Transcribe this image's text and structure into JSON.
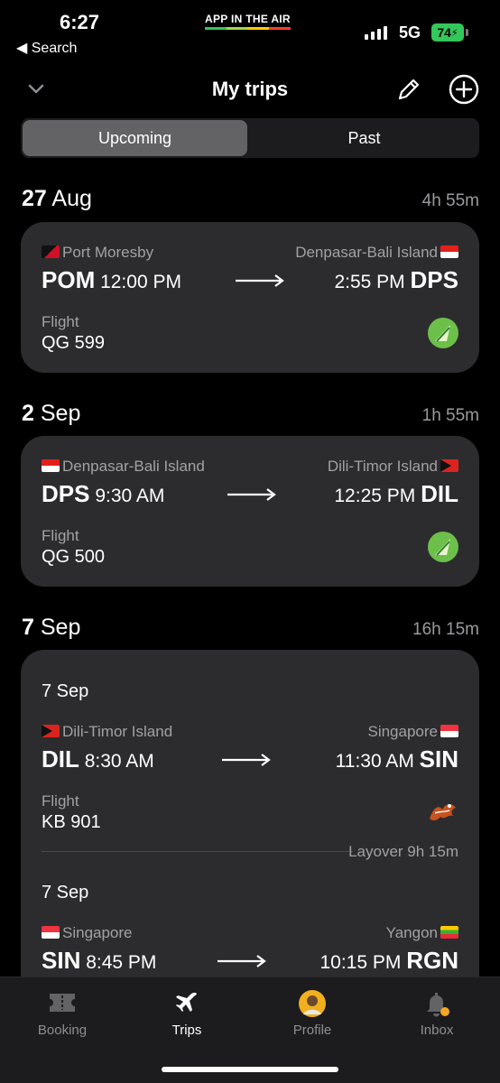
{
  "status_bar": {
    "time": "6:27",
    "back_label": "◀ Search",
    "app_banner": "APP IN THE AIR",
    "network": "5G",
    "battery": "74"
  },
  "nav": {
    "title": "My trips"
  },
  "segments": {
    "upcoming": "Upcoming",
    "past": "Past",
    "selected": "Upcoming"
  },
  "trips": [
    {
      "date_day": "27",
      "date_month": "Aug",
      "duration": "4h 55m",
      "legs": [
        {
          "from_city": "Port Moresby",
          "to_city": "Denpasar-Bali Island",
          "from_code": "POM",
          "dep_time": "12:00 PM",
          "arr_time": "2:55 PM",
          "to_code": "DPS",
          "type_label": "Flight",
          "flight_number": "QG 599"
        }
      ]
    },
    {
      "date_day": "2",
      "date_month": "Sep",
      "duration": "1h 55m",
      "legs": [
        {
          "from_city": "Denpasar-Bali Island",
          "to_city": "Dili-Timor Island",
          "from_code": "DPS",
          "dep_time": "9:30 AM",
          "arr_time": "12:25 PM",
          "to_code": "DIL",
          "type_label": "Flight",
          "flight_number": "QG 500"
        }
      ]
    },
    {
      "date_day": "7",
      "date_month": "Sep",
      "duration": "16h 15m",
      "legs": [
        {
          "leg_date": "7 Sep",
          "from_city": "Dili-Timor Island",
          "to_city": "Singapore",
          "from_code": "DIL",
          "dep_time": "8:30 AM",
          "arr_time": "11:30 AM",
          "to_code": "SIN",
          "type_label": "Flight",
          "flight_number": "KB 901",
          "layover": "Layover 9h 15m"
        },
        {
          "leg_date": "7 Sep",
          "from_city": "Singapore",
          "to_city": "Yangon",
          "from_code": "SIN",
          "dep_time": "8:45 PM",
          "arr_time": "10:15 PM",
          "to_code": "RGN"
        }
      ]
    }
  ],
  "tabbar": {
    "items": [
      {
        "label": "Booking",
        "icon": "booking-icon"
      },
      {
        "label": "Trips",
        "icon": "airplane-icon"
      },
      {
        "label": "Profile",
        "icon": "avatar"
      },
      {
        "label": "Inbox",
        "icon": "bell-icon"
      }
    ],
    "active": "Trips"
  },
  "colors": {
    "accent_green": "#34c759",
    "card_bg": "#2c2c2e",
    "secondary_text": "#a1a1a6",
    "citilink_green": "#6cc04a"
  }
}
